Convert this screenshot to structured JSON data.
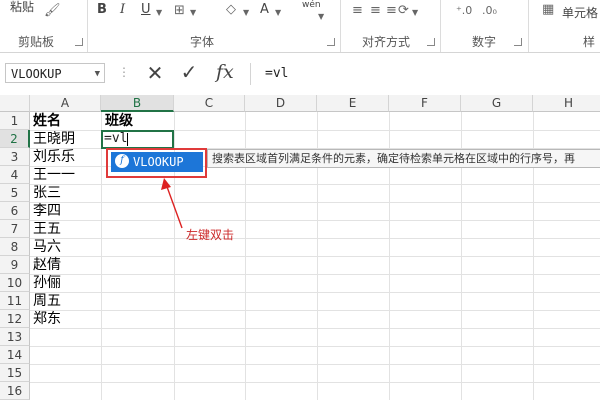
{
  "ribbon": {
    "paste_label": "粘贴",
    "groups": {
      "clipboard": "剪贴板",
      "font": "字体",
      "alignment": "对齐方式",
      "number": "数字",
      "styles": "样"
    },
    "bold": "B",
    "italic": "I",
    "underline": "U",
    "font_color": "A",
    "phonetic": "wén",
    "number_format_big": "单元格",
    "accent_color": "#217346"
  },
  "formula_bar": {
    "name_box": "VLOOKUP",
    "cancel": "✕",
    "enter": "✓",
    "fx": "fx",
    "value": "=vl"
  },
  "columns": [
    "A",
    "B",
    "C",
    "D",
    "E",
    "F",
    "G",
    "H"
  ],
  "rows": [
    "1",
    "2",
    "3",
    "4",
    "5",
    "6",
    "7",
    "8",
    "9",
    "10",
    "11",
    "12",
    "13",
    "14",
    "15",
    "16"
  ],
  "cells": {
    "A1": "姓名",
    "B1": "班级",
    "A2": "王晓明",
    "A3": "刘乐乐",
    "A4": "王一一",
    "A5": "张三",
    "A6": "李四",
    "A7": "王五",
    "A8": "马六",
    "A9": "赵倩",
    "A10": "孙俪",
    "A11": "周五",
    "A12": "郑东",
    "B2": "=vl"
  },
  "autocomplete": {
    "item": "VLOOKUP",
    "tooltip": "搜索表区域首列满足条件的元素，确定待检索单元格在区域中的行序号，再"
  },
  "annotation": "左键双击",
  "highlight_color": "#e03a3a"
}
